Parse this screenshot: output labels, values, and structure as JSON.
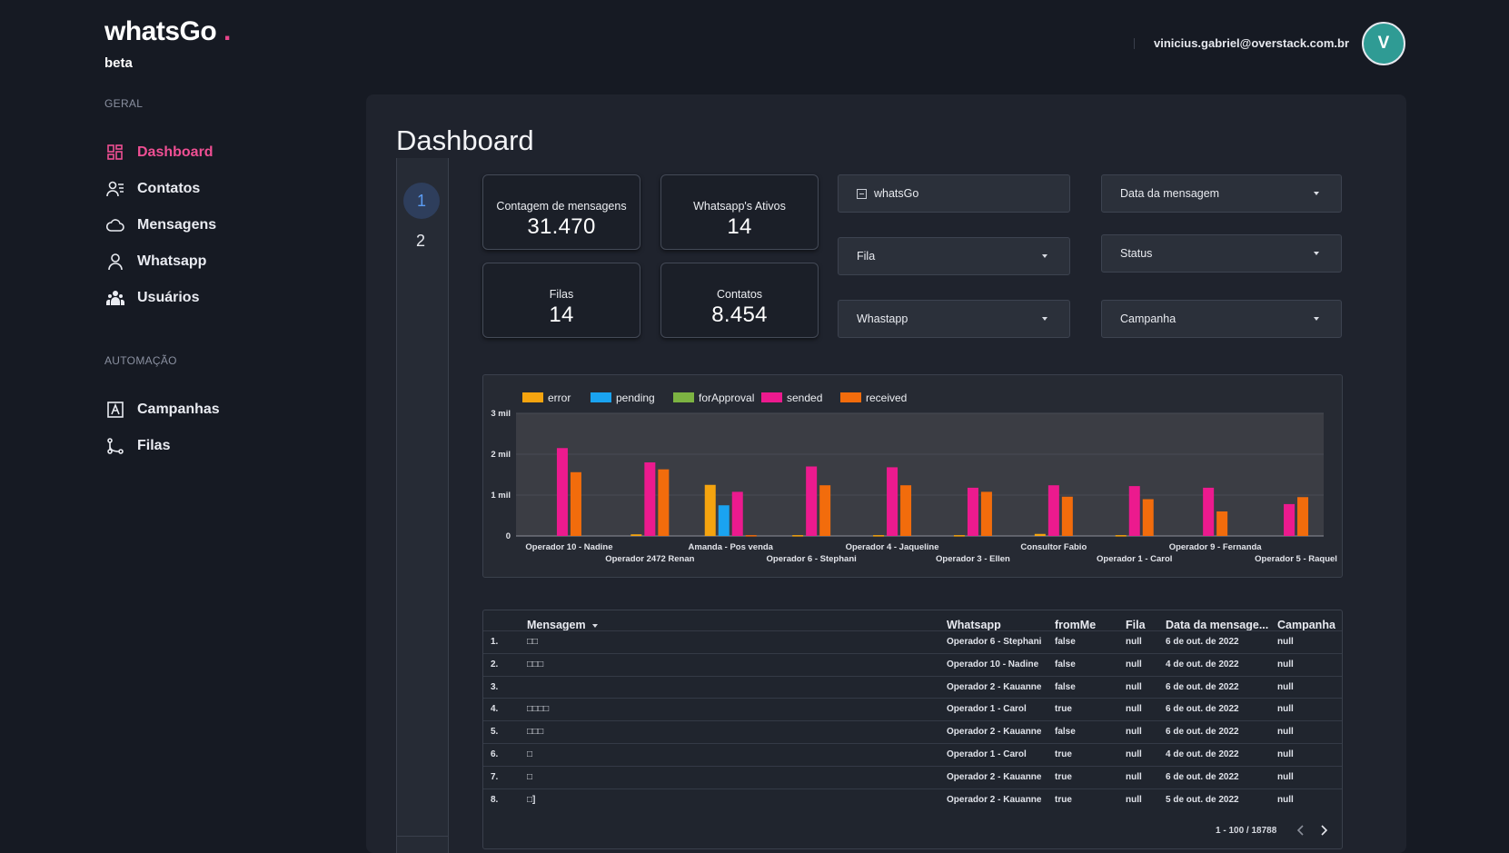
{
  "app": {
    "brand": "whatsGo",
    "brand_dot": ".",
    "version": "beta"
  },
  "user": {
    "email": "vinicius.gabriel@overstack.com.br",
    "avatar_initial": "V"
  },
  "sidebar": {
    "section_general": "GERAL",
    "section_automation": "AUTOMAÇÃO",
    "items": [
      {
        "label": "Dashboard",
        "icon": "dashboard-icon",
        "active": true
      },
      {
        "label": "Contatos",
        "icon": "contacts-icon"
      },
      {
        "label": "Mensagens",
        "icon": "cloud-icon"
      },
      {
        "label": "Whatsapp",
        "icon": "person-icon"
      },
      {
        "label": "Usuários",
        "icon": "users-icon"
      },
      {
        "label": "Campanhas",
        "icon": "campaign-icon"
      },
      {
        "label": "Filas",
        "icon": "queue-icon"
      }
    ]
  },
  "page": {
    "title": "Dashboard",
    "pages": [
      "1",
      "2"
    ],
    "current_page": "1"
  },
  "kpis": [
    {
      "label": "Contagem de mensagens",
      "value": "31.470"
    },
    {
      "label": "Whatsapp's Ativos",
      "value": "14"
    },
    {
      "label": "Filas",
      "value": "14"
    },
    {
      "label": "Contatos",
      "value": "8.454"
    }
  ],
  "filters": {
    "whatsgo": "whatsGo",
    "data_mensagem": "Data da mensagem",
    "fila": "Fila",
    "status": "Status",
    "whastapp": "Whastapp",
    "campanha": "Campanha"
  },
  "colors": {
    "accent": "#ef4f93",
    "error": "#f5a40f",
    "pending": "#1aa3f0",
    "forApproval": "#7cb342",
    "sended": "#ec1a8e",
    "received": "#f26c0c"
  },
  "chart_data": {
    "type": "bar",
    "legend": [
      "error",
      "pending",
      "forApproval",
      "sended",
      "received"
    ],
    "y_ticks": [
      "0",
      "1 mil",
      "2 mil",
      "3 mil"
    ],
    "ylim": [
      0,
      3000
    ],
    "categories": [
      "Operador 10 - Nadine",
      "Operador 2472 Renan",
      "Amanda - Pos venda",
      "Operador 6 - Stephani",
      "Operador 4 - Jaqueline",
      "Operador 3 - Ellen",
      "Consultor Fabio",
      "Operador 1 - Carol",
      "Operador 9 - Fernanda",
      "Operador 5 - Raquel"
    ],
    "series": [
      {
        "name": "error",
        "values": [
          0,
          40,
          1250,
          20,
          20,
          20,
          50,
          20,
          0,
          0
        ]
      },
      {
        "name": "pending",
        "values": [
          0,
          0,
          750,
          0,
          0,
          0,
          0,
          0,
          0,
          0
        ]
      },
      {
        "name": "forApproval",
        "values": [
          0,
          0,
          0,
          0,
          0,
          0,
          0,
          0,
          0,
          0
        ]
      },
      {
        "name": "sended",
        "values": [
          2150,
          1800,
          1080,
          1700,
          1680,
          1180,
          1240,
          1220,
          1180,
          780
        ]
      },
      {
        "name": "received",
        "values": [
          1560,
          1630,
          20,
          1240,
          1240,
          1080,
          960,
          900,
          600,
          950
        ]
      }
    ]
  },
  "table": {
    "columns": [
      "Mensagem",
      "Whatsapp",
      "fromMe",
      "Fila",
      "Data da mensage...",
      "Campanha"
    ],
    "rows": [
      {
        "n": "1.",
        "msg": "□□",
        "whatsapp": "Operador 6 - Stephani",
        "fromMe": "false",
        "fila": "null",
        "data": "6 de out. de 2022",
        "campanha": "null"
      },
      {
        "n": "2.",
        "msg": "□□□",
        "whatsapp": "Operador 10 - Nadine",
        "fromMe": "false",
        "fila": "null",
        "data": "4 de out. de 2022",
        "campanha": "null"
      },
      {
        "n": "3.",
        "msg": "",
        "whatsapp": "Operador 2 - Kauanne",
        "fromMe": "false",
        "fila": "null",
        "data": "6 de out. de 2022",
        "campanha": "null"
      },
      {
        "n": "4.",
        "msg": "□□□□",
        "whatsapp": "Operador 1 - Carol",
        "fromMe": "true",
        "fila": "null",
        "data": "6 de out. de 2022",
        "campanha": "null"
      },
      {
        "n": "5.",
        "msg": "□□□",
        "whatsapp": "Operador 2 - Kauanne",
        "fromMe": "false",
        "fila": "null",
        "data": "6 de out. de 2022",
        "campanha": "null"
      },
      {
        "n": "6.",
        "msg": "□",
        "whatsapp": "Operador 1 - Carol",
        "fromMe": "true",
        "fila": "null",
        "data": "4 de out. de 2022",
        "campanha": "null"
      },
      {
        "n": "7.",
        "msg": "□",
        "whatsapp": "Operador 2 - Kauanne",
        "fromMe": "true",
        "fila": "null",
        "data": "6 de out. de 2022",
        "campanha": "null"
      },
      {
        "n": "8.",
        "msg": "□]",
        "whatsapp": "Operador 2 - Kauanne",
        "fromMe": "true",
        "fila": "null",
        "data": "5 de out. de 2022",
        "campanha": "null"
      }
    ],
    "pagination": "1 - 100 / 18788"
  }
}
